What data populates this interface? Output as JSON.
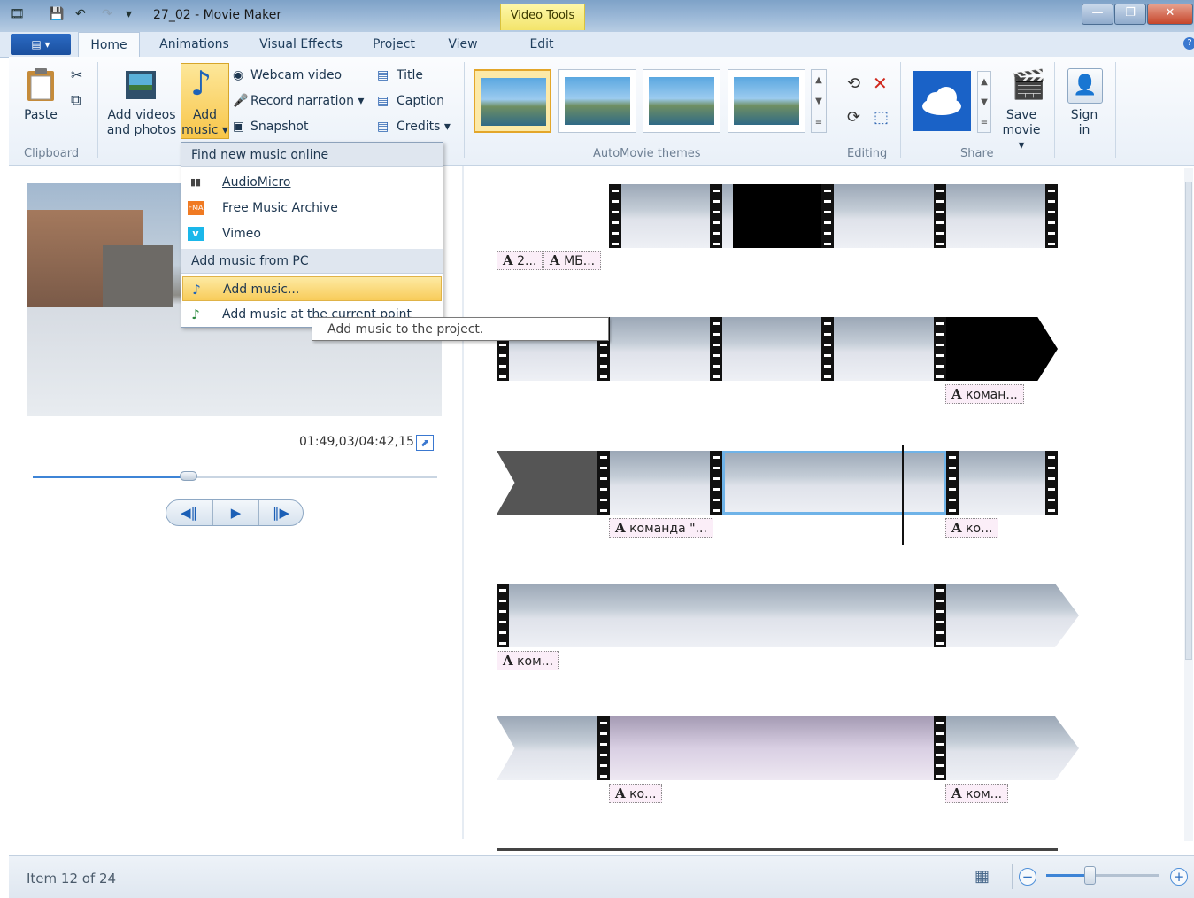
{
  "window": {
    "title": "27_02 - Movie Maker",
    "context_tab": "Video Tools",
    "controls": {
      "minimize": "—",
      "maximize": "❐",
      "close": "✕"
    }
  },
  "tabs": [
    "Home",
    "Animations",
    "Visual Effects",
    "Project",
    "View",
    "Edit"
  ],
  "file_button": "▤ ▾",
  "ribbon": {
    "clipboard": {
      "paste": "Paste",
      "group": "Clipboard"
    },
    "add": {
      "add_videos_line1": "Add videos",
      "add_videos_line2": "and photos",
      "add_music_line1": "Add",
      "add_music_line2": "music ▾",
      "webcam": "Webcam video",
      "narration": "Record narration ▾",
      "snapshot": "Snapshot",
      "title": "Title",
      "caption": "Caption",
      "credits": "Credits ▾"
    },
    "themes_group": "AutoMovie themes",
    "editing_group": "Editing",
    "share": {
      "group": "Share",
      "save_line1": "Save",
      "save_line2": "movie ▾",
      "sign_line1": "Sign",
      "sign_line2": "in"
    }
  },
  "menu": {
    "section1": "Find new music online",
    "items_online": [
      {
        "label": "AudioMicro",
        "icon": "audiomicro-icon"
      },
      {
        "label": "Free Music Archive",
        "icon": "fma-icon"
      },
      {
        "label": "Vimeo",
        "icon": "vimeo-icon"
      }
    ],
    "section2": "Add music from PC",
    "add_music": "Add music...",
    "add_music_at_point": "Add music at the current point",
    "tooltip": "Add music to the project."
  },
  "player": {
    "time": "01:49,03/04:42,15",
    "position_fraction": 0.385
  },
  "captions": {
    "row1_a": "2...",
    "row1_b": "МБ...",
    "row2": "коман...",
    "row3_a": "команда \"...",
    "row3_b": "ко...",
    "row4": "ком...",
    "row5_a": "ко...",
    "row5_b": "ком..."
  },
  "status": {
    "text": "Item 12 of 24",
    "zoom_fraction": 0.38
  },
  "colors": {
    "accent": "#3d84d6",
    "menu_highlight": "#f8cc5a",
    "caption_bg": "#fbeef8"
  }
}
